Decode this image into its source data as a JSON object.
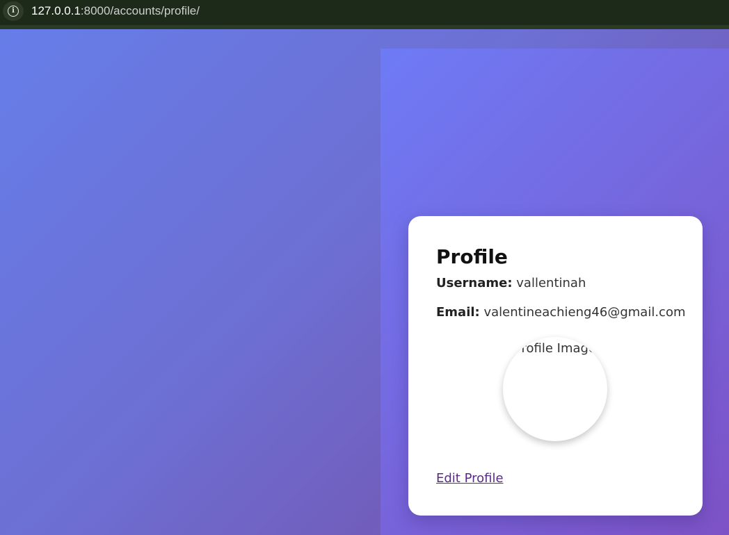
{
  "browser": {
    "url_host": "127.0.0.1",
    "url_path": ":8000/accounts/profile/",
    "info_icon": "info-icon"
  },
  "profile": {
    "title": "Profile",
    "username_label": "Username:",
    "username_value": "vallentinah",
    "email_label": "Email:",
    "email_value": "valentineachieng46@gmail.com",
    "image_alt": "Profile Image",
    "edit_link": "Edit Profile"
  },
  "colors": {
    "bg_start": "#667eea",
    "bg_end": "#764ba2",
    "link": "#5b2a86"
  }
}
